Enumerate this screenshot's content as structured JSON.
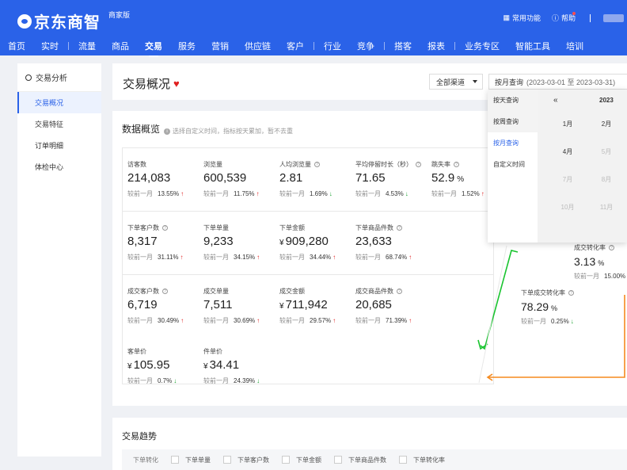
{
  "brand": {
    "name": "京东商智",
    "edition": "商家版"
  },
  "util": {
    "common": "常用功能",
    "help": "帮助"
  },
  "nav": [
    "首页",
    "实时",
    "流量",
    "商品",
    "交易",
    "服务",
    "营销",
    "供应链",
    "客户",
    "行业",
    "竞争",
    "搭客",
    "报表",
    "业务专区",
    "智能工具",
    "培训"
  ],
  "sidebar": {
    "title": "交易分析",
    "items": [
      "交易概况",
      "交易特征",
      "订单明细",
      "体检中心"
    ]
  },
  "header": {
    "title": "交易概况",
    "channel": "全部渠道",
    "date_mode": "按月查询",
    "date_range": "(2023-03-01 至 2023-03-31)"
  },
  "overview": {
    "title": "数据概览",
    "hint": "选择自定义时间，指标按天累加，暂不去重"
  },
  "compare_label": "较前一月",
  "metrics": [
    [
      {
        "label": "访客数",
        "value": "214,083",
        "pct": "13.55%",
        "dir": "↑",
        "help": false
      },
      {
        "label": "浏览量",
        "value": "600,539",
        "pct": "11.75%",
        "dir": "↑",
        "help": false
      },
      {
        "label": "人均浏览量",
        "value": "2.81",
        "pct": "1.69%",
        "dir": "↓",
        "help": true
      },
      {
        "label": "平均停留时长（秒）",
        "value": "71.65",
        "pct": "4.53%",
        "dir": "↓",
        "help": true
      },
      {
        "label": "跳失率",
        "value": "52.9",
        "unit": "%",
        "pct": "1.52%",
        "dir": "↑",
        "help": true
      }
    ],
    [
      {
        "label": "下单客户数",
        "value": "8,317",
        "pct": "31.11%",
        "dir": "↑",
        "help": true
      },
      {
        "label": "下单单量",
        "value": "9,233",
        "pct": "34.15%",
        "dir": "↑",
        "help": false
      },
      {
        "label": "下单金额",
        "value": "909,280",
        "cur": "¥",
        "pct": "34.44%",
        "dir": "↑",
        "help": false
      },
      {
        "label": "下单商品件数",
        "value": "23,633",
        "pct": "68.74%",
        "dir": "↑",
        "help": true
      }
    ],
    [
      {
        "label": "成交客户数",
        "value": "6,719",
        "pct": "30.49%",
        "dir": "↑",
        "help": true
      },
      {
        "label": "成交单量",
        "value": "7,511",
        "pct": "30.69%",
        "dir": "↑",
        "help": false
      },
      {
        "label": "成交金额",
        "value": "711,942",
        "cur": "¥",
        "pct": "29.57%",
        "dir": "↑",
        "help": false
      },
      {
        "label": "成交商品件数",
        "value": "20,685",
        "pct": "71.39%",
        "dir": "↑",
        "help": true
      }
    ],
    [
      {
        "label": "客单价",
        "value": "105.95",
        "cur": "¥",
        "pct": "0.7%",
        "dir": "↓",
        "help": false
      },
      {
        "label": "件单价",
        "value": "34.41",
        "cur": "¥",
        "pct": "24.39%",
        "dir": "↓",
        "help": false
      }
    ]
  ],
  "funnel": [
    {
      "label": "成交转化率",
      "value": "3.13",
      "unit": "%",
      "pct": "15.00%",
      "dir": ""
    },
    {
      "label": "下单成交转化率",
      "value": "78.29",
      "unit": "%",
      "pct": "0.25%",
      "dir": "↓"
    }
  ],
  "datepicker": {
    "modes": [
      "按天查询",
      "按周查询",
      "按月查询",
      "自定义时间"
    ],
    "active_mode": "按月查询",
    "nav": "«",
    "year": "2023",
    "months": [
      {
        "label": "1月",
        "enabled": true
      },
      {
        "label": "2月",
        "enabled": true
      },
      {
        "label": "4月",
        "enabled": true
      },
      {
        "label": "5月",
        "enabled": false
      },
      {
        "label": "7月",
        "enabled": false
      },
      {
        "label": "8月",
        "enabled": false
      },
      {
        "label": "10月",
        "enabled": false
      },
      {
        "label": "11月",
        "enabled": false
      }
    ]
  },
  "trend": {
    "title": "交易趋势",
    "row_label": "下单转化",
    "options": [
      "下单单量",
      "下单客户数",
      "下单金额",
      "下单商品件数",
      "下单转化率"
    ]
  },
  "colors": {
    "primary": "#2a62e8",
    "up": "#e02020",
    "down": "#19a12f",
    "arrow_green": "#19c42f",
    "arrow_orange": "#f58a1f"
  }
}
